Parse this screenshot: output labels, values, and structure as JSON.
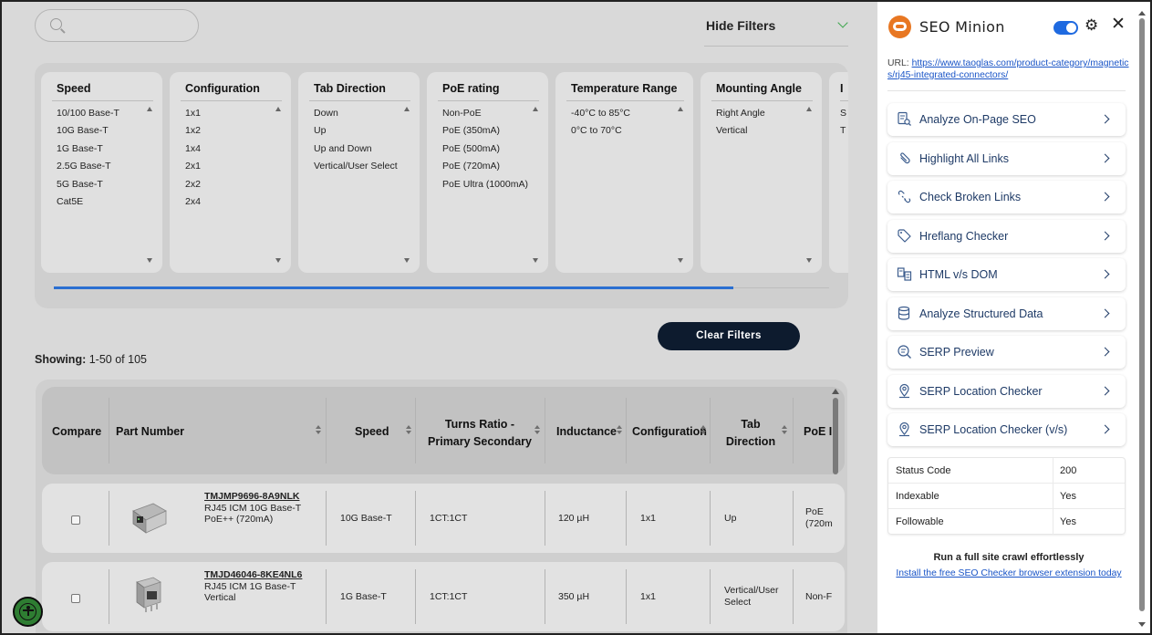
{
  "search": {
    "placeholder": ""
  },
  "hide_filters_label": "Hide Filters",
  "filters": [
    {
      "title": "Speed",
      "options": [
        "10/100 Base-T",
        "10G Base-T",
        "1G Base-T",
        "2.5G Base-T",
        "5G Base-T",
        "Cat5E"
      ]
    },
    {
      "title": "Configuration",
      "options": [
        "1x1",
        "1x2",
        "1x4",
        "2x1",
        "2x2",
        "2x4"
      ]
    },
    {
      "title": "Tab Direction",
      "options": [
        "Down",
        "Up",
        "Up and Down",
        "Vertical/User Select"
      ]
    },
    {
      "title": "PoE rating",
      "options": [
        "Non-PoE",
        "PoE (350mA)",
        "PoE (500mA)",
        "PoE (720mA)",
        "PoE Ultra (1000mA)"
      ]
    },
    {
      "title": "Temperature Range",
      "options": [
        "-40°C to 85°C",
        "0°C to 70°C"
      ]
    },
    {
      "title": "Mounting Angle",
      "options": [
        "Right Angle",
        "Vertical"
      ]
    },
    {
      "title": "I",
      "options": [
        "S",
        "T"
      ]
    }
  ],
  "clear_filters_label": "Clear Filters",
  "showing": {
    "label": "Showing:",
    "value": " 1-50 of 105"
  },
  "table": {
    "headers": {
      "compare": "Compare",
      "part_number": "Part Number",
      "speed": "Speed",
      "turns_ratio_1": "Turns Ratio -",
      "turns_ratio_2": "Primary Secondary",
      "inductance": "Inductance",
      "configuration": "Configuration",
      "tab_direction_1": "Tab",
      "tab_direction_2": "Direction",
      "poe": "PoE I"
    },
    "rows": [
      {
        "part_number": "TMJMP9696-8A9NLK",
        "desc_1": "RJ45 ICM 10G Base-T",
        "desc_2": "PoE++ (720mA)",
        "speed": "10G Base-T",
        "turns_ratio": "1CT:1CT",
        "inductance": "120 µH",
        "configuration": "1x1",
        "tab_direction_1": "Up",
        "tab_direction_2": "",
        "poe_1": "PoE",
        "poe_2": "(720m"
      },
      {
        "part_number": "TMJD46046-8KE4NL6",
        "desc_1": "RJ45 ICM 1G Base-T",
        "desc_2": "Vertical",
        "speed": "1G Base-T",
        "turns_ratio": "1CT:1CT",
        "inductance": "350 µH",
        "configuration": "1x1",
        "tab_direction_1": "Vertical/User",
        "tab_direction_2": "Select",
        "poe_1": "Non-F",
        "poe_2": ""
      }
    ]
  },
  "panel": {
    "title": "SEO Minion",
    "toggle_on": true,
    "url_label": "URL: ",
    "url": "https://www.taoglas.com/product-category/magnetics/rj45-integrated-connectors/",
    "menu": [
      {
        "label": "Analyze On-Page SEO",
        "icon": "analyze-page-icon"
      },
      {
        "label": "Highlight All Links",
        "icon": "link-icon"
      },
      {
        "label": "Check Broken Links",
        "icon": "broken-link-icon"
      },
      {
        "label": "Hreflang Checker",
        "icon": "tag-icon"
      },
      {
        "label": "HTML v/s DOM",
        "icon": "compare-icon"
      },
      {
        "label": "Analyze Structured Data",
        "icon": "database-icon"
      },
      {
        "label": "SERP Preview",
        "icon": "search-list-icon"
      },
      {
        "label": "SERP Location Checker",
        "icon": "location-pin-icon"
      },
      {
        "label": "SERP Location Checker (v/s)",
        "icon": "location-pin-icon"
      }
    ],
    "status": [
      {
        "key": "Status Code",
        "value": "200"
      },
      {
        "key": "Indexable",
        "value": "Yes"
      },
      {
        "key": "Followable",
        "value": "Yes"
      }
    ],
    "crawl_text": "Run a full site crawl effortlessly",
    "install_link": "Install the free SEO Checker browser extension today"
  },
  "colors": {
    "accent_blue": "#1f6ae0",
    "logo_orange": "#e87722",
    "menu_text": "#1e3a66",
    "clear_button": "#0d1b2e",
    "chevron_green": "#3aa54a"
  }
}
